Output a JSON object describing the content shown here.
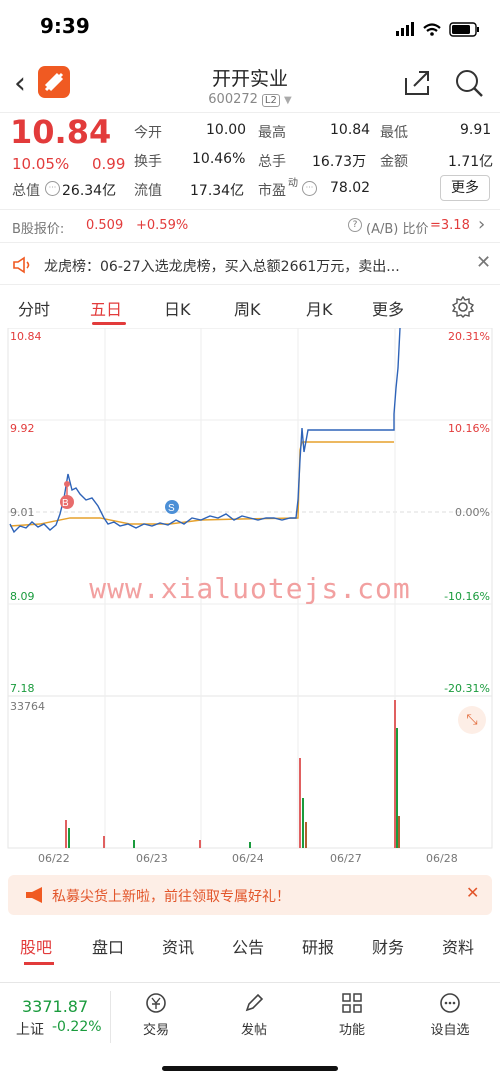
{
  "status": {
    "time": "9:39"
  },
  "header": {
    "title": "开开实业",
    "code": "600272",
    "level": "L2"
  },
  "quote": {
    "price": "10.84",
    "change_pct": "10.05%",
    "change": "0.99",
    "today_open_label": "今开",
    "today_open": "10.00",
    "high_label": "最高",
    "high": "10.84",
    "low_label": "最低",
    "low": "9.91",
    "turnover_label": "换手",
    "turnover": "10.46%",
    "volume_label": "总手",
    "volume": "16.73万",
    "amount_label": "金额",
    "amount": "1.71亿",
    "mktcap_label": "总值",
    "mktcap": "26.34亿",
    "float_label": "流值",
    "float": "17.34亿",
    "pe_label": "市盈",
    "pe_sup": "动",
    "pe": "78.02",
    "more_label": "更多"
  },
  "bshare": {
    "label": "B股报价:",
    "price": "0.509",
    "pct": "+0.59%",
    "ratio_label": "(A/B) 比价",
    "ratio": "=3.18"
  },
  "notice": {
    "text": "龙虎榜：06-27入选龙虎榜，买入总额2661万元，卖出..."
  },
  "chart_tabs": [
    "分时",
    "五日",
    "日K",
    "周K",
    "月K",
    "更多"
  ],
  "chart": {
    "y_left": [
      "10.84",
      "9.92",
      "9.01",
      "8.09",
      "7.18"
    ],
    "y_right": [
      "20.31%",
      "10.16%",
      "0.00%",
      "-10.16%",
      "-20.31%"
    ],
    "vol_max": "33764",
    "x_labels": [
      "06/22",
      "06/23",
      "06/24",
      "06/27",
      "06/28"
    ],
    "watermark": "www.xialuotejs.com",
    "marker_b": "B",
    "marker_s": "S"
  },
  "chart_data": {
    "type": "line",
    "title": "",
    "x": [
      "06/22",
      "06/23",
      "06/24",
      "06/27",
      "06/28"
    ],
    "ylim": [
      7.18,
      10.84
    ],
    "series": [],
    "daily_close_approx": [
      9.2,
      8.97,
      9.0,
      9.92,
      10.84
    ]
  },
  "banner": {
    "text": "私募尖货上新啦，前往领取专属好礼！"
  },
  "bottom_tabs": [
    "股吧",
    "盘口",
    "资讯",
    "公告",
    "研报",
    "财务",
    "资料"
  ],
  "footer": {
    "index_value": "3371.87",
    "index_name": "上证",
    "index_pct": "-0.22%",
    "items": [
      "交易",
      "发帖",
      "功能",
      "设自选"
    ]
  }
}
